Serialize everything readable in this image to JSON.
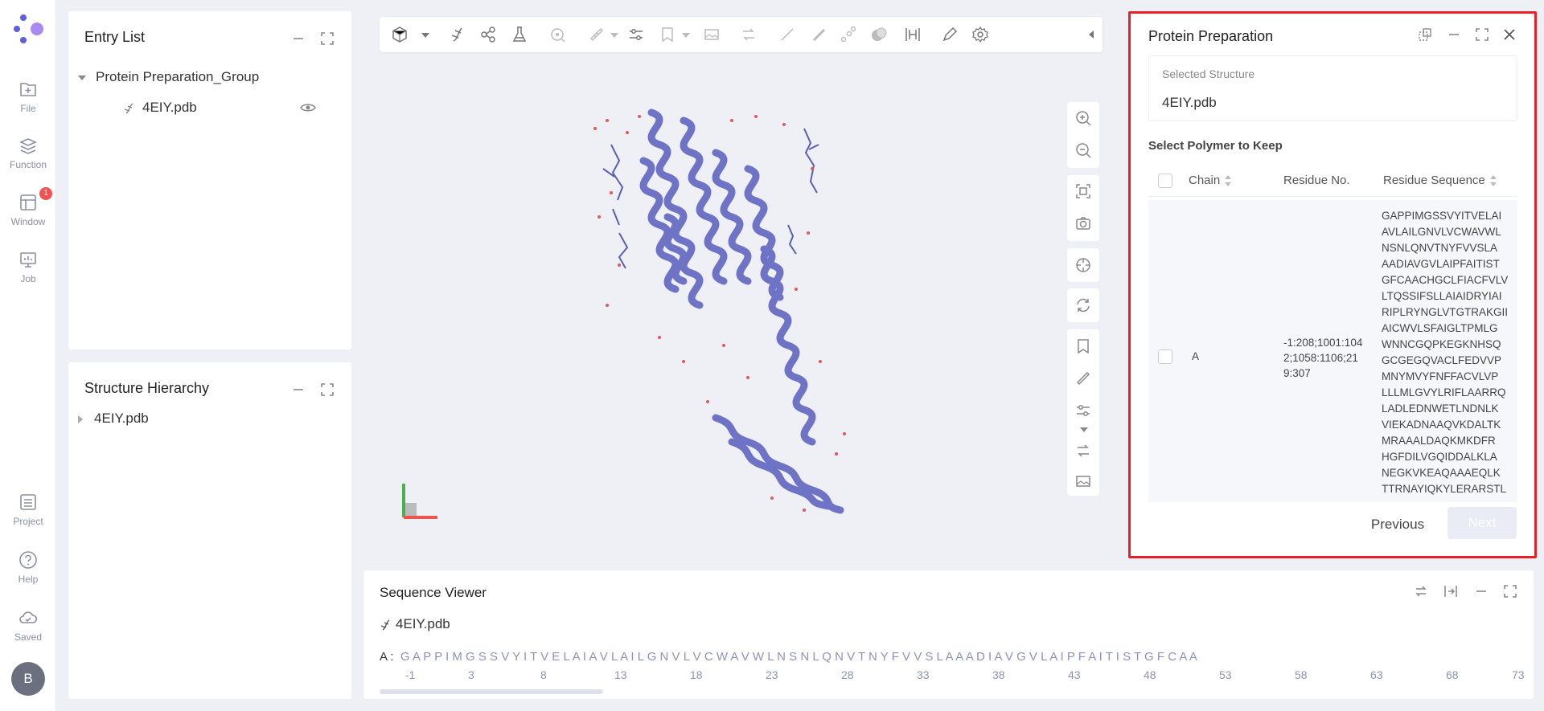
{
  "rail": {
    "items": [
      {
        "label": "File",
        "icon": "file-add-icon"
      },
      {
        "label": "Function",
        "icon": "function-icon"
      },
      {
        "label": "Window",
        "icon": "window-icon",
        "badge": "1"
      },
      {
        "label": "Job",
        "icon": "job-icon"
      },
      {
        "label": "Project",
        "icon": "project-icon"
      },
      {
        "label": "Help",
        "icon": "help-icon"
      },
      {
        "label": "Saved",
        "icon": "cloud-icon"
      }
    ],
    "avatar": "B"
  },
  "entry_list": {
    "title": "Entry List",
    "group": "Protein Preparation_Group",
    "file": "4EIY.pdb"
  },
  "structure_hierarchy": {
    "title": "Structure Hierarchy",
    "item": "4EIY.pdb"
  },
  "protein_prep": {
    "title": "Protein Preparation",
    "selected_label": "Selected Structure",
    "selected_value": "4EIY.pdb",
    "section_title": "Select Polymer to Keep",
    "columns": {
      "chain": "Chain",
      "residue_no": "Residue No.",
      "residue_seq": "Residue Sequence"
    },
    "row": {
      "chain": "A",
      "residue_no_lines": [
        "-1:208;1001:104",
        "2;1058:1106;21",
        "9:307"
      ],
      "sequence_lines": [
        "GAPPIMGSSVYITVELAI",
        "AVLAILGNVLVCWAVWL",
        "NSNLQNVTNYFVVSLA",
        "AADIAVGVLAIPFAITIST",
        "GFCAACHGCLFIACFVLV",
        "LTQSSIFSLLAIAIDRYIAI",
        "RIPLRYNGLVTGTRAKGII",
        "AICWVLSFAIGLTPMLG",
        "WNNCGQPKEGKNHSQ",
        "GCGEGQVACLFEDVVP",
        "MNYMVYFNFFACVLVP",
        "LLLMLGVYLRIFLAARRQ",
        "LADLEDNWETLNDNLK",
        "VIEKADNAAQVKDALTK",
        "MRAAALDAQKMKDFR",
        "HGFDILVGQIDDALKLA",
        "NEGKVKEAQAAAEQLK",
        "TTRNAYIQKYLERARSTL"
      ]
    },
    "previous": "Previous",
    "next": "Next"
  },
  "sequence_viewer": {
    "title": "Sequence Viewer",
    "file": "4EIY.pdb",
    "chain_label": "A :",
    "letters": "G A P P I M G S S V Y I T V E L A I A V L A I L G N V L V C W A V W L N S N L Q N V T N Y F V V S L A A A D I A V G V L A I P F A I T I S T G F C A A",
    "numbers": [
      "-1",
      "3",
      "8",
      "13",
      "18",
      "23",
      "28",
      "33",
      "38",
      "43",
      "48",
      "53",
      "58",
      "63",
      "68",
      "73"
    ]
  },
  "colors": {
    "accent": "#6c5ce7",
    "protein": "#6f73c6",
    "highlight_border": "#e8202a"
  }
}
